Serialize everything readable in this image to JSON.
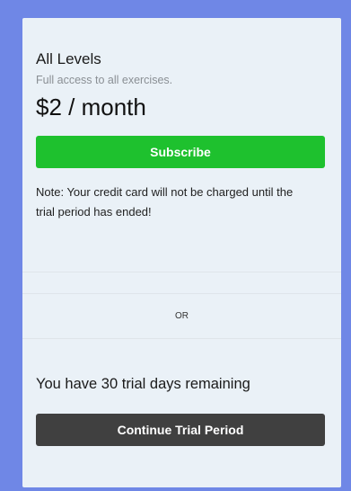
{
  "plan": {
    "name": "All Levels",
    "description": "Full access to all exercises.",
    "price": "$2 / month"
  },
  "subscribe_label": "Subscribe",
  "note": "Note: Your credit card will not be charged until the trial period has ended!",
  "or_label": "OR",
  "trial_text": "You have 30 trial days remaining",
  "continue_label": "Continue Trial Period",
  "colors": {
    "background": "#6f87e6",
    "card": "#eaf1f7",
    "subscribe_button": "#1ec12e",
    "continue_button": "#404040"
  }
}
